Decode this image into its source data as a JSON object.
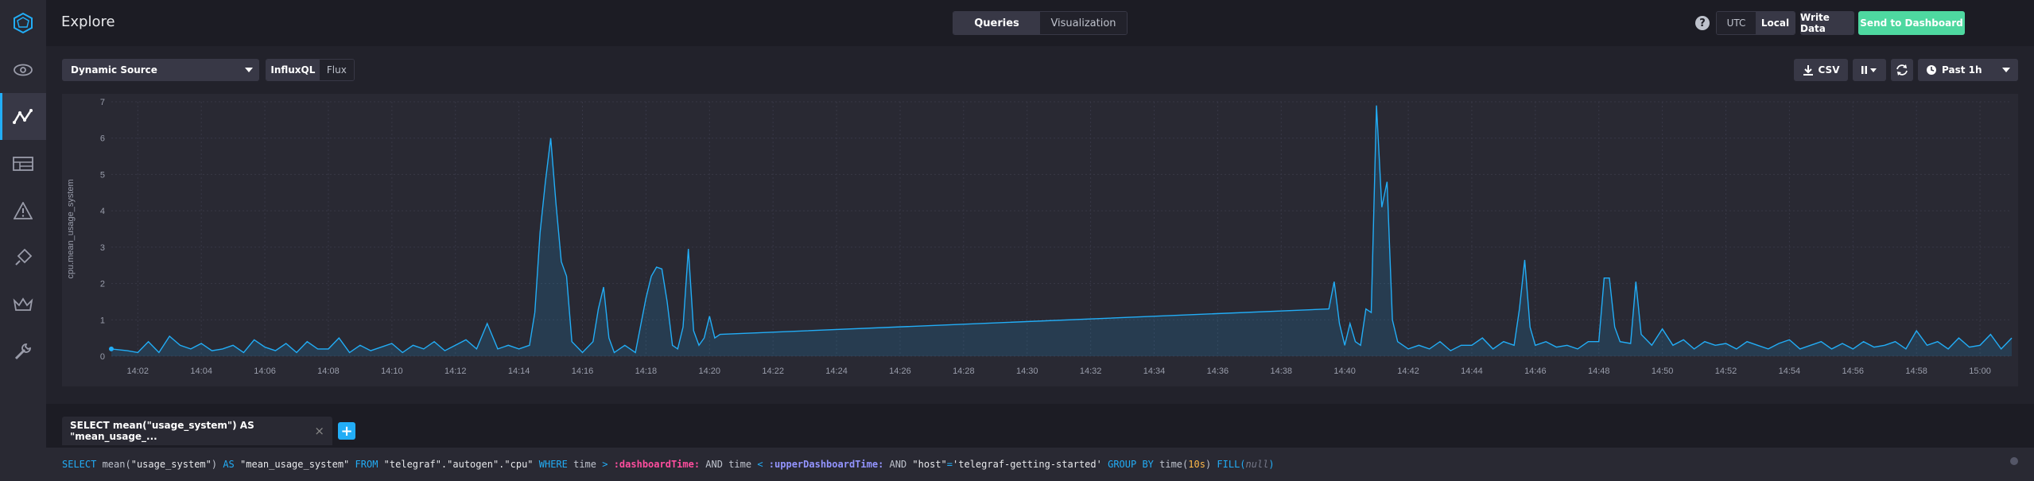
{
  "header": {
    "title": "Explore",
    "tabs": [
      "Queries",
      "Visualization"
    ],
    "active_tab": "Queries",
    "help": "?",
    "timezones": [
      "UTC",
      "Local"
    ],
    "write_data": "Write Data",
    "send_dashboard": "Send to Dashboard"
  },
  "toolbar": {
    "source": "Dynamic Source",
    "languages": [
      "InfluxQL",
      "Flux"
    ],
    "csv": "CSV",
    "time_range": "Past 1h"
  },
  "query": {
    "tab_label": "SELECT mean(\"usage_system\") AS \"mean_usage_...",
    "close": "×",
    "add": "+",
    "text_parts": [
      {
        "t": "SELECT",
        "c": "kw"
      },
      {
        "t": " mean(",
        "c": ""
      },
      {
        "t": "\"usage_system\"",
        "c": "str"
      },
      {
        "t": ") ",
        "c": ""
      },
      {
        "t": "AS",
        "c": "kw"
      },
      {
        "t": " ",
        "c": ""
      },
      {
        "t": "\"mean_usage_system\"",
        "c": "str"
      },
      {
        "t": " ",
        "c": ""
      },
      {
        "t": "FROM",
        "c": "kw"
      },
      {
        "t": " ",
        "c": ""
      },
      {
        "t": "\"telegraf\".\"autogen\".\"cpu\"",
        "c": "str"
      },
      {
        "t": " ",
        "c": ""
      },
      {
        "t": "WHERE",
        "c": "kw"
      },
      {
        "t": " time ",
        "c": ""
      },
      {
        "t": ">",
        "c": "kw"
      },
      {
        "t": " ",
        "c": ""
      },
      {
        "t": ":dashboardTime:",
        "c": "tvar"
      },
      {
        "t": " AND time ",
        "c": ""
      },
      {
        "t": "<",
        "c": "kw"
      },
      {
        "t": " ",
        "c": ""
      },
      {
        "t": ":upperDashboardTime:",
        "c": "tvar2"
      },
      {
        "t": " AND ",
        "c": ""
      },
      {
        "t": "\"host\"",
        "c": "str"
      },
      {
        "t": "=",
        "c": "kw"
      },
      {
        "t": "'telegraf-getting-started'",
        "c": "str"
      },
      {
        "t": " ",
        "c": ""
      },
      {
        "t": "GROUP BY",
        "c": "kw"
      },
      {
        "t": " time(",
        "c": ""
      },
      {
        "t": "10s",
        "c": "num"
      },
      {
        "t": ") ",
        "c": ""
      },
      {
        "t": "FILL(",
        "c": "kw"
      },
      {
        "t": "null",
        "c": "nul"
      },
      {
        "t": ")",
        "c": "kw"
      }
    ]
  },
  "icons": {
    "logo": "influx-logo-icon",
    "nav": [
      "eye-icon",
      "graph-icon",
      "dashboards-icon",
      "alert-icon",
      "plug-icon",
      "crown-icon",
      "wrench-icon"
    ]
  },
  "colors": {
    "accent": "#22adf6",
    "send": "#4ed8a0",
    "series": "#22adf6"
  },
  "chart_data": {
    "type": "area",
    "ylabel": "cpu.mean_usage_system",
    "ylim": [
      0,
      7
    ],
    "yticks": [
      0,
      1,
      2,
      3,
      4,
      5,
      6,
      7
    ],
    "xlim": [
      "14:01:10",
      "15:01:00"
    ],
    "xticks": [
      "14:02",
      "14:04",
      "14:06",
      "14:08",
      "14:10",
      "14:12",
      "14:14",
      "14:16",
      "14:18",
      "14:20",
      "14:22",
      "14:24",
      "14:26",
      "14:28",
      "14:30",
      "14:32",
      "14:34",
      "14:36",
      "14:38",
      "14:40",
      "14:42",
      "14:44",
      "14:46",
      "14:48",
      "14:50",
      "14:52",
      "14:54",
      "14:56",
      "14:58",
      "15:00"
    ],
    "grid": true,
    "series": [
      {
        "points": [
          [
            "14:01:10",
            0.2
          ],
          [
            "14:01:40",
            0.15
          ],
          [
            "14:02:00",
            0.1
          ],
          [
            "14:02:20",
            0.4
          ],
          [
            "14:02:40",
            0.1
          ],
          [
            "14:03:00",
            0.55
          ],
          [
            "14:03:20",
            0.3
          ],
          [
            "14:03:40",
            0.2
          ],
          [
            "14:04:00",
            0.35
          ],
          [
            "14:04:20",
            0.15
          ],
          [
            "14:04:40",
            0.2
          ],
          [
            "14:05:00",
            0.3
          ],
          [
            "14:05:20",
            0.1
          ],
          [
            "14:05:40",
            0.45
          ],
          [
            "14:06:00",
            0.25
          ],
          [
            "14:06:20",
            0.15
          ],
          [
            "14:06:40",
            0.35
          ],
          [
            "14:07:00",
            0.1
          ],
          [
            "14:07:20",
            0.4
          ],
          [
            "14:07:40",
            0.2
          ],
          [
            "14:08:00",
            0.2
          ],
          [
            "14:08:20",
            0.5
          ],
          [
            "14:08:40",
            0.1
          ],
          [
            "14:09:00",
            0.3
          ],
          [
            "14:09:20",
            0.15
          ],
          [
            "14:09:40",
            0.25
          ],
          [
            "14:10:00",
            0.35
          ],
          [
            "14:10:20",
            0.1
          ],
          [
            "14:10:40",
            0.3
          ],
          [
            "14:11:00",
            0.2
          ],
          [
            "14:11:20",
            0.4
          ],
          [
            "14:11:40",
            0.15
          ],
          [
            "14:12:00",
            0.3
          ],
          [
            "14:12:20",
            0.45
          ],
          [
            "14:12:40",
            0.2
          ],
          [
            "14:13:00",
            0.9
          ],
          [
            "14:13:20",
            0.2
          ],
          [
            "14:13:40",
            0.3
          ],
          [
            "14:14:00",
            0.2
          ],
          [
            "14:14:20",
            0.3
          ],
          [
            "14:14:30",
            1.2
          ],
          [
            "14:14:40",
            3.4
          ],
          [
            "14:14:50",
            4.8
          ],
          [
            "14:15:00",
            6.0
          ],
          [
            "14:15:10",
            4.2
          ],
          [
            "14:15:20",
            2.6
          ],
          [
            "14:15:30",
            2.2
          ],
          [
            "14:15:40",
            0.4
          ],
          [
            "14:16:00",
            0.1
          ],
          [
            "14:16:20",
            0.4
          ],
          [
            "14:16:30",
            1.3
          ],
          [
            "14:16:40",
            1.9
          ],
          [
            "14:16:50",
            0.5
          ],
          [
            "14:17:00",
            0.1
          ],
          [
            "14:17:20",
            0.3
          ],
          [
            "14:17:40",
            0.1
          ],
          [
            "14:18:00",
            1.6
          ],
          [
            "14:18:10",
            2.2
          ],
          [
            "14:18:20",
            2.45
          ],
          [
            "14:18:30",
            2.4
          ],
          [
            "14:18:40",
            1.5
          ],
          [
            "14:18:50",
            0.3
          ],
          [
            "14:19:00",
            0.2
          ],
          [
            "14:19:10",
            0.8
          ],
          [
            "14:19:20",
            2.95
          ],
          [
            "14:19:30",
            0.7
          ],
          [
            "14:19:40",
            0.3
          ],
          [
            "14:19:50",
            0.5
          ],
          [
            "14:20:00",
            1.1
          ],
          [
            "14:20:10",
            0.5
          ],
          [
            "14:20:20",
            0.6
          ],
          [
            "14:39:30",
            1.3
          ],
          [
            "14:39:40",
            2.05
          ],
          [
            "14:39:50",
            0.9
          ],
          [
            "14:40:00",
            0.3
          ],
          [
            "14:40:10",
            0.9
          ],
          [
            "14:40:20",
            0.4
          ],
          [
            "14:40:30",
            0.3
          ],
          [
            "14:40:40",
            1.3
          ],
          [
            "14:40:50",
            1.2
          ],
          [
            "14:41:00",
            6.9
          ],
          [
            "14:41:10",
            4.1
          ],
          [
            "14:41:20",
            4.8
          ],
          [
            "14:41:30",
            1.0
          ],
          [
            "14:41:40",
            0.4
          ],
          [
            "14:42:00",
            0.2
          ],
          [
            "14:42:20",
            0.3
          ],
          [
            "14:42:40",
            0.2
          ],
          [
            "14:43:00",
            0.4
          ],
          [
            "14:43:20",
            0.15
          ],
          [
            "14:43:40",
            0.3
          ],
          [
            "14:44:00",
            0.3
          ],
          [
            "14:44:20",
            0.5
          ],
          [
            "14:44:40",
            0.2
          ],
          [
            "14:45:00",
            0.4
          ],
          [
            "14:45:20",
            0.3
          ],
          [
            "14:45:30",
            1.3
          ],
          [
            "14:45:40",
            2.65
          ],
          [
            "14:45:50",
            0.8
          ],
          [
            "14:46:00",
            0.3
          ],
          [
            "14:46:20",
            0.4
          ],
          [
            "14:46:40",
            0.25
          ],
          [
            "14:47:00",
            0.3
          ],
          [
            "14:47:20",
            0.2
          ],
          [
            "14:47:40",
            0.4
          ],
          [
            "14:48:00",
            0.4
          ],
          [
            "14:48:10",
            2.15
          ],
          [
            "14:48:20",
            2.15
          ],
          [
            "14:48:30",
            0.8
          ],
          [
            "14:48:40",
            0.4
          ],
          [
            "14:49:00",
            0.35
          ],
          [
            "14:49:10",
            2.05
          ],
          [
            "14:49:20",
            0.6
          ],
          [
            "14:49:40",
            0.3
          ],
          [
            "14:50:00",
            0.75
          ],
          [
            "14:50:20",
            0.3
          ],
          [
            "14:50:40",
            0.45
          ],
          [
            "14:51:00",
            0.2
          ],
          [
            "14:51:20",
            0.4
          ],
          [
            "14:51:40",
            0.3
          ],
          [
            "14:52:00",
            0.35
          ],
          [
            "14:52:20",
            0.2
          ],
          [
            "14:52:40",
            0.4
          ],
          [
            "14:53:00",
            0.3
          ],
          [
            "14:53:20",
            0.2
          ],
          [
            "14:53:40",
            0.35
          ],
          [
            "14:54:00",
            0.45
          ],
          [
            "14:54:20",
            0.2
          ],
          [
            "14:54:40",
            0.3
          ],
          [
            "14:55:00",
            0.4
          ],
          [
            "14:55:20",
            0.2
          ],
          [
            "14:55:40",
            0.35
          ],
          [
            "14:56:00",
            0.2
          ],
          [
            "14:56:20",
            0.4
          ],
          [
            "14:56:40",
            0.25
          ],
          [
            "14:57:00",
            0.3
          ],
          [
            "14:57:20",
            0.4
          ],
          [
            "14:57:40",
            0.2
          ],
          [
            "14:58:00",
            0.7
          ],
          [
            "14:58:20",
            0.3
          ],
          [
            "14:58:40",
            0.4
          ],
          [
            "14:59:00",
            0.2
          ],
          [
            "14:59:20",
            0.5
          ],
          [
            "14:59:40",
            0.25
          ],
          [
            "15:00:00",
            0.3
          ],
          [
            "15:00:20",
            0.6
          ],
          [
            "15:00:40",
            0.2
          ],
          [
            "15:01:00",
            0.5
          ]
        ]
      }
    ]
  }
}
